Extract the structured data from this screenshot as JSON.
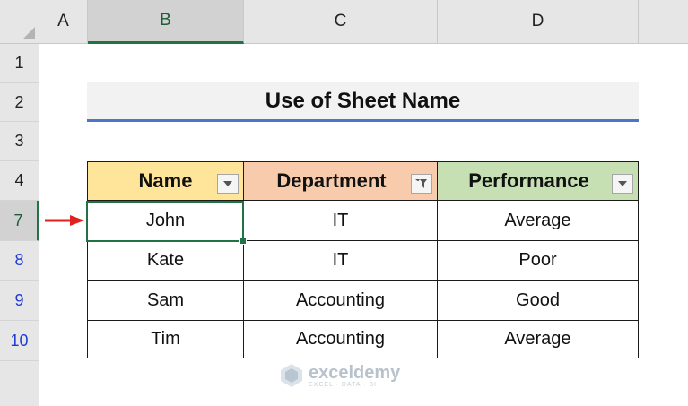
{
  "columns": [
    "A",
    "B",
    "C",
    "D"
  ],
  "rows": [
    "1",
    "2",
    "3",
    "4",
    "7",
    "8",
    "9",
    "10"
  ],
  "title": "Use of Sheet Name",
  "table": {
    "headers": [
      "Name",
      "Department",
      "Performance"
    ],
    "rows": [
      [
        "John",
        "IT",
        "Average"
      ],
      [
        "Kate",
        "IT",
        "Poor"
      ],
      [
        "Sam",
        "Accounting",
        "Good"
      ],
      [
        "Tim",
        "Accounting",
        "Average"
      ]
    ]
  },
  "watermark": {
    "name": "exceldemy",
    "tagline": "EXCEL · DATA · BI"
  },
  "colors": {
    "excel_green": "#217346",
    "header_name": "#ffe59a",
    "header_department": "#f8cbad",
    "header_performance": "#c6e0b4",
    "title_underline": "#4a76c6",
    "arrow": "#e0211d",
    "filtered_row_numbers": "#1f3bd6"
  },
  "icons": [
    "select-all-triangle-icon",
    "filter-dropdown-icon",
    "filter-active-icon",
    "red-arrow-icon",
    "exceldemy-logo-icon"
  ]
}
